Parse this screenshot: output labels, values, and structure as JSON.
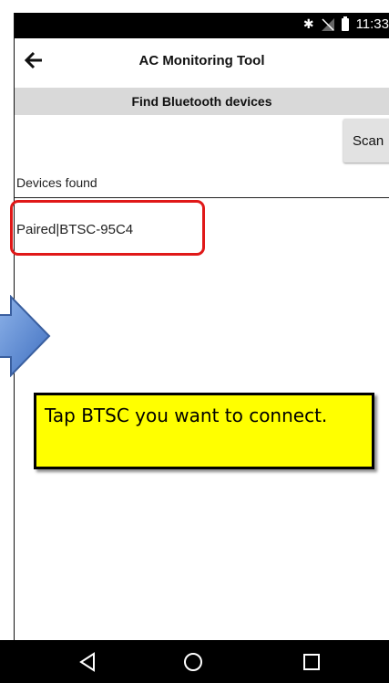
{
  "status_bar": {
    "time": "11:33",
    "icons": [
      "bluetooth-icon",
      "no-signal-icon",
      "battery-icon"
    ]
  },
  "app_bar": {
    "title": "AC Monitoring Tool",
    "back_icon": "back-arrow-icon"
  },
  "section": {
    "title": "Find Bluetooth devices"
  },
  "scan_button": {
    "label": "Scan"
  },
  "devices": {
    "label": "Devices found",
    "items": [
      {
        "label": "Paired|BTSC-95C4"
      }
    ]
  },
  "annotation": {
    "tooltip_text": "Tap BTSC you want to connect.",
    "highlight_color": "#e01818",
    "tooltip_color": "#ffff00",
    "arrow_color": "#5b8fd8"
  },
  "nav_bar": {
    "buttons": [
      "back-triangle-icon",
      "home-circle-icon",
      "recents-square-icon"
    ]
  }
}
